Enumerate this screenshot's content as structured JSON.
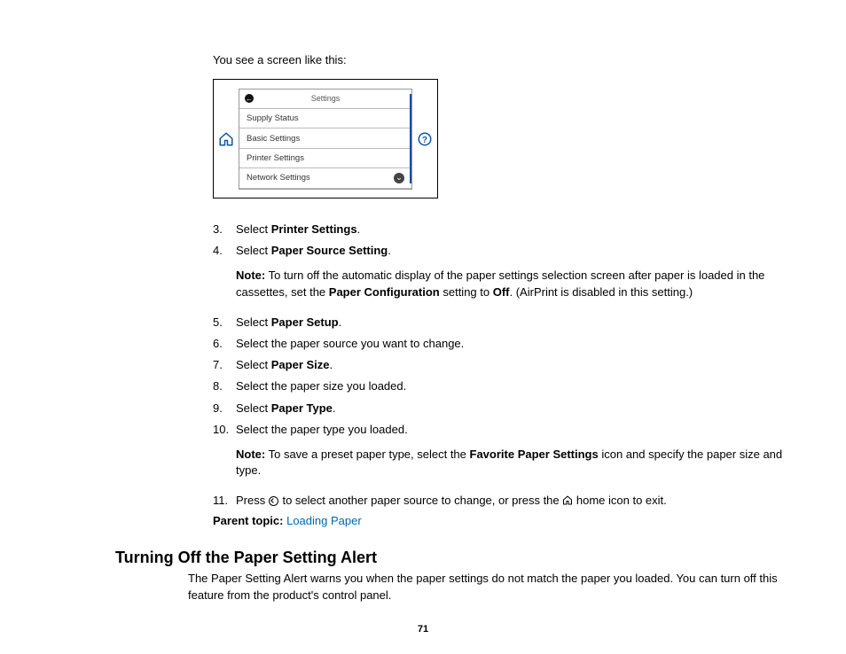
{
  "intro": "You see a screen like this:",
  "screen": {
    "header": "Settings",
    "rows": [
      "Supply Status",
      "Basic Settings",
      "Printer Settings",
      "Network Settings"
    ]
  },
  "steps": {
    "s3": {
      "num": "3.",
      "pre": "Select ",
      "bold": "Printer Settings",
      "post": "."
    },
    "s4": {
      "num": "4.",
      "pre": "Select ",
      "bold": "Paper Source Setting",
      "post": "."
    },
    "note4_pre": "Note:",
    "note4_body1": " To turn off the automatic display of the paper settings selection screen after paper is loaded in the cassettes, set the ",
    "note4_bold": "Paper Configuration",
    "note4_body2": " setting to ",
    "note4_bold2": "Off",
    "note4_body3": ". (AirPrint is disabled in this setting.)",
    "s5": {
      "num": "5.",
      "pre": "Select ",
      "bold": "Paper Setup",
      "post": "."
    },
    "s6": {
      "num": "6.",
      "text": "Select the paper source you want to change."
    },
    "s7": {
      "num": "7.",
      "pre": "Select ",
      "bold": "Paper Size",
      "post": "."
    },
    "s8": {
      "num": "8.",
      "text": "Select the paper size you loaded."
    },
    "s9": {
      "num": "9.",
      "pre": "Select ",
      "bold": "Paper Type",
      "post": "."
    },
    "s10": {
      "num": "10.",
      "text": "Select the paper type you loaded."
    },
    "note10_pre": "Note:",
    "note10_body1": " To save a preset paper type, select the ",
    "note10_bold": "Favorite Paper Settings",
    "note10_body2": " icon and specify the paper size and type.",
    "s11": {
      "num": "11.",
      "text1": "Press ",
      "text2": " to select another paper source to change, or press the ",
      "text3": " home icon to exit."
    }
  },
  "parent_topic_label": "Parent topic:",
  "parent_topic_link": "Loading Paper",
  "section_heading": "Turning Off the Paper Setting Alert",
  "section_body": "The Paper Setting Alert warns you when the paper settings do not match the paper you loaded. You can turn off this feature from the product's control panel.",
  "page_number": "71"
}
